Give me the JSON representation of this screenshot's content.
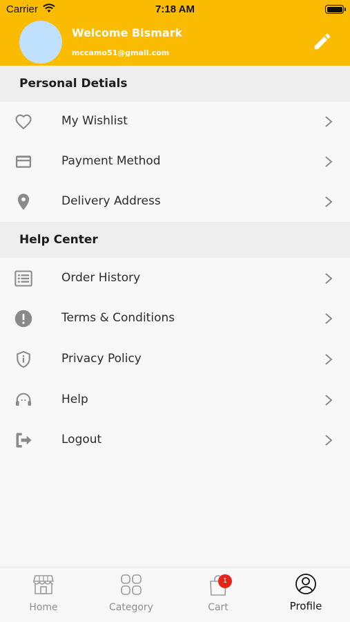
{
  "status_bar": {
    "carrier": "Carrier",
    "time": "7:18 AM"
  },
  "profile": {
    "welcome": "Welcome Bismark",
    "email": "mccamo51@gmail.com"
  },
  "sections": [
    {
      "title": "Personal Detials",
      "items": [
        {
          "label": "My Wishlist",
          "icon": "heart-icon"
        },
        {
          "label": "Payment Method",
          "icon": "credit-card-icon"
        },
        {
          "label": "Delivery Address",
          "icon": "location-pin-icon"
        }
      ]
    },
    {
      "title": "Help Center",
      "items": [
        {
          "label": "Order History",
          "icon": "list-icon"
        },
        {
          "label": "Terms & Conditions",
          "icon": "alert-icon"
        },
        {
          "label": "Privacy Policy",
          "icon": "shield-icon"
        },
        {
          "label": "Help",
          "icon": "headset-icon"
        },
        {
          "label": "Logout",
          "icon": "logout-icon"
        }
      ]
    }
  ],
  "tabs": [
    {
      "label": "Home",
      "icon": "store-icon"
    },
    {
      "label": "Category",
      "icon": "grid-icon"
    },
    {
      "label": "Cart",
      "icon": "bag-icon",
      "badge": "1"
    },
    {
      "label": "Profile",
      "icon": "user-circle-icon",
      "active": true
    }
  ],
  "colors": {
    "header": "#fbbb00",
    "avatar": "#bfe0ff",
    "badge": "#e8231a",
    "section_bg": "#eeeeee"
  }
}
